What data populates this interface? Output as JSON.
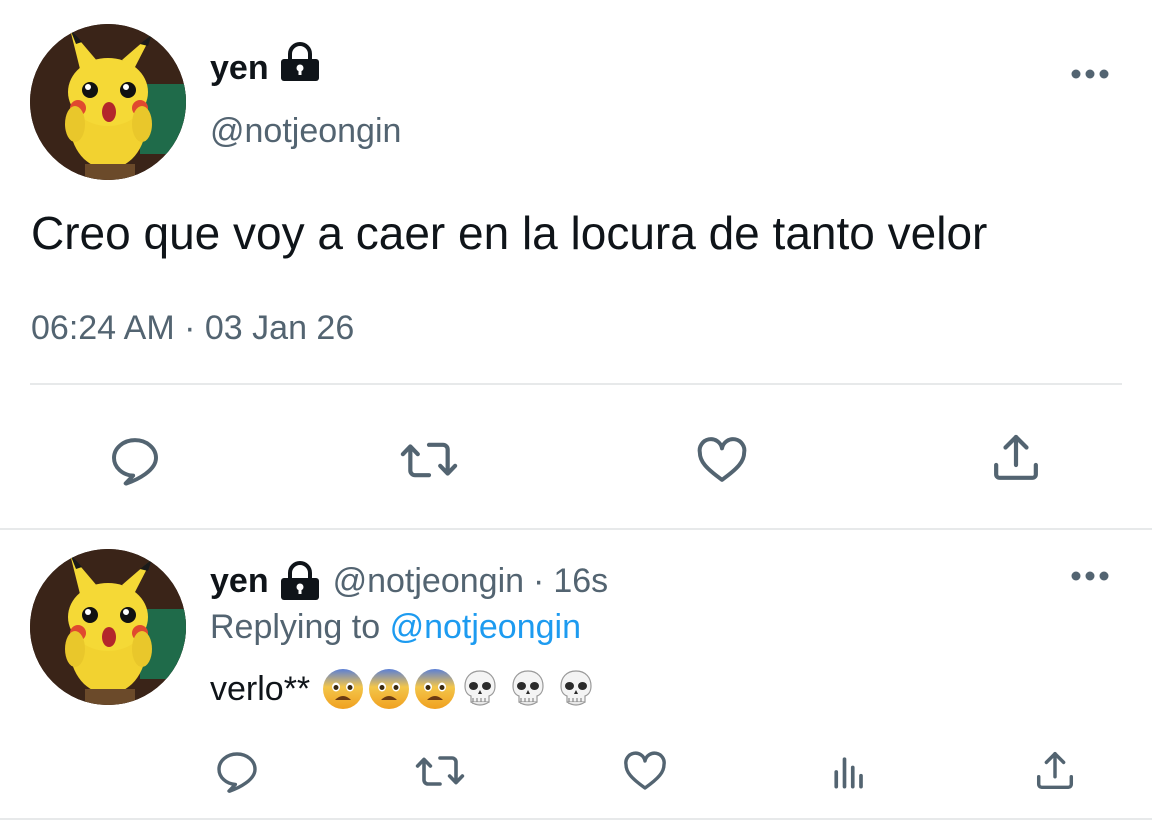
{
  "main_tweet": {
    "display_name": "yen",
    "handle": "@notjeongin",
    "text": "Creo que voy a caer en la locura de tanto velor",
    "time": "06:24 AM",
    "separator": "·",
    "date": "03 Jan 26",
    "icons": {
      "avatar": "pikachu-avatar",
      "lock": "lock-icon",
      "more": "more-icon",
      "reply": "reply-icon",
      "retweet": "retweet-icon",
      "like": "heart-icon",
      "share": "share-icon"
    }
  },
  "reply_tweet": {
    "display_name": "yen",
    "handle": "@notjeongin",
    "separator": "·",
    "age": "16s",
    "replying_prefix": "Replying to",
    "replying_handle": "@notjeongin",
    "text": "verlo**",
    "emojis": [
      "fearful-face",
      "fearful-face",
      "fearful-face",
      "skull",
      "skull",
      "skull"
    ],
    "icons": {
      "reply": "reply-icon",
      "retweet": "retweet-icon",
      "like": "heart-icon",
      "analytics": "analytics-icon",
      "share": "share-icon"
    }
  },
  "colors": {
    "text": "#0f1419",
    "secondary": "#536471",
    "link": "#1d9bf0",
    "divider": "#e7e9ea"
  }
}
